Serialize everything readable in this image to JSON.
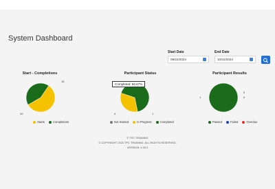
{
  "page_title": "System Dashboard",
  "filters": {
    "start_label": "Start Date",
    "start_value": "09/22/2024",
    "end_label": "End Date",
    "end_value": "10/22/2024",
    "search_icon": "search-icon"
  },
  "charts": {
    "completions": {
      "title": "Start - Completions",
      "legend": [
        "Starts",
        "Completions"
      ],
      "labels": [
        "15",
        "20"
      ]
    },
    "status": {
      "title": "Participant Status",
      "tooltip": "Completed: 66.67%",
      "legend": [
        "Not Started",
        "In Progress",
        "Completed"
      ],
      "labels": [
        "0",
        "1"
      ]
    },
    "results": {
      "title": "Participant Results",
      "legend": [
        "Passed",
        "Failed",
        "Overdue"
      ],
      "labels": [
        "0",
        "0",
        "1"
      ]
    }
  },
  "chart_data": [
    {
      "type": "pie",
      "title": "Start - Completions",
      "categories": [
        "Starts",
        "Completions"
      ],
      "values": [
        20,
        15
      ],
      "colors": [
        "#f5c200",
        "#1a6b1a"
      ]
    },
    {
      "type": "pie",
      "title": "Participant Status",
      "categories": [
        "Not Started",
        "In Progress",
        "Completed"
      ],
      "values": [
        0,
        1,
        2
      ],
      "colors": [
        "#7a7a7a",
        "#f5c200",
        "#1a6b1a"
      ]
    },
    {
      "type": "pie",
      "title": "Participant Results",
      "categories": [
        "Passed",
        "Failed",
        "Overdue"
      ],
      "values": [
        1,
        0,
        0
      ],
      "colors": [
        "#1a6b1a",
        "#1f3fbf",
        "#e0301e"
      ]
    }
  ],
  "footer": {
    "line1": "© TPC TRAINING",
    "line2": "© COPYRIGHT 2024 TPC TRAINING. ALL RIGHTS RESERVED.",
    "line3": "VERSION: 4.33.0"
  }
}
